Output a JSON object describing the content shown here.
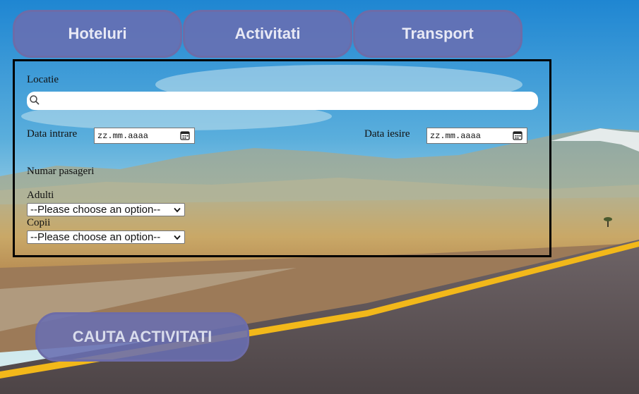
{
  "tabs": {
    "hotels": "Hoteluri",
    "activities": "Activitati",
    "transport": "Transport"
  },
  "form": {
    "location_label": "Locatie",
    "location_value": "",
    "checkin_label": "Data intrare",
    "checkin_placeholder": "zz.mm.aaaa",
    "checkout_label": "Data iesire",
    "checkout_placeholder": "zz.mm.aaaa",
    "passengers_label": "Numar pasageri",
    "adults_label": "Adulti",
    "adults_selected": "--Please choose an option--",
    "children_label": "Copii",
    "children_selected": "--Please choose an option--"
  },
  "search_button": "CAUTA ACTIVITATI",
  "icons": {
    "search": "search-icon",
    "calendar": "calendar-icon",
    "dropdown": "chevron-down-icon"
  },
  "colors": {
    "tab_fill": "#6a6eb2",
    "tab_border": "#6d6ca8",
    "tab_text": "#e8e9f5",
    "form_border": "#000000",
    "road_line": "#f2b81a"
  }
}
